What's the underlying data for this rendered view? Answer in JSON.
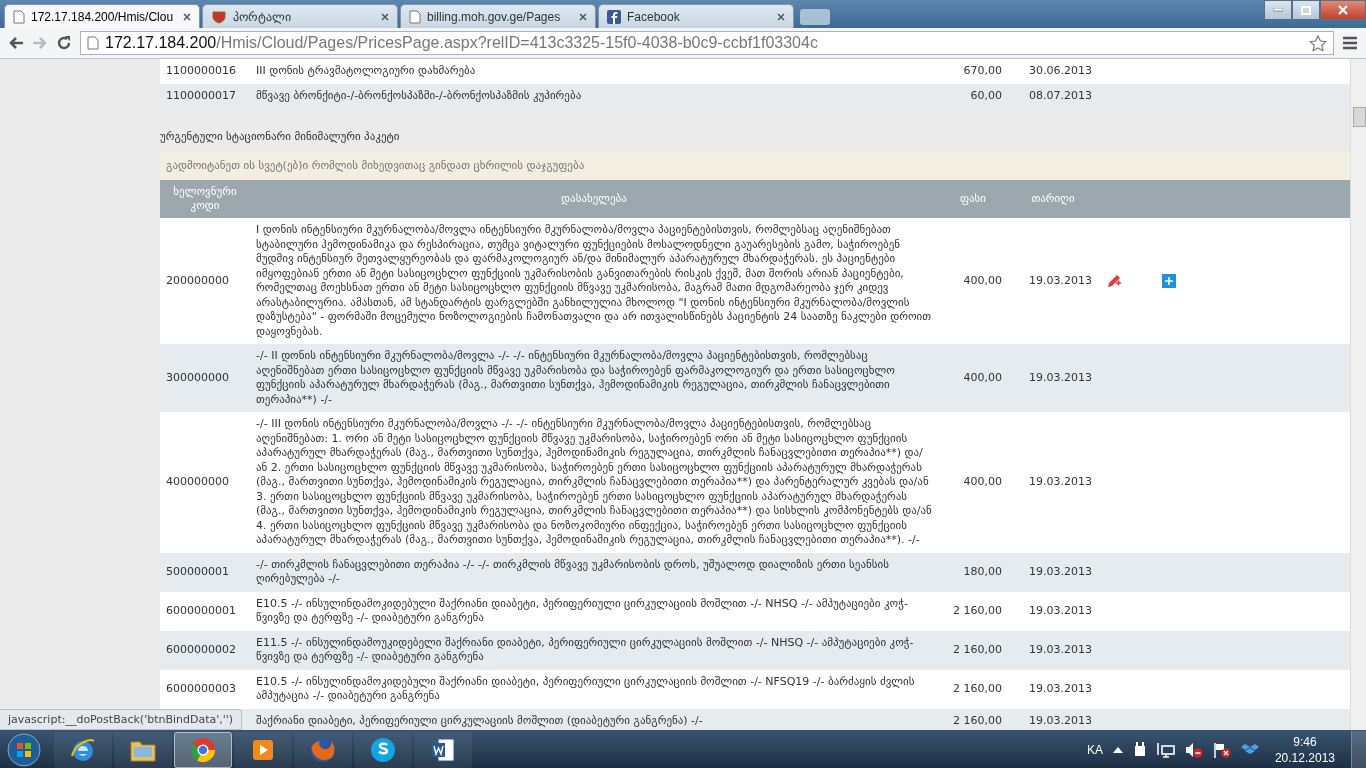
{
  "browser": {
    "tabs": [
      {
        "title": "172.17.184.200/Hmis/Clou",
        "kind": "page",
        "selected": true
      },
      {
        "title": "პორტალი",
        "kind": "emblem",
        "selected": false
      },
      {
        "title": "billing.moh.gov.ge/Pages",
        "kind": "page",
        "selected": false
      },
      {
        "title": "Facebook",
        "kind": "facebook",
        "selected": false
      }
    ],
    "address": {
      "host": "172.17.184.200",
      "path": "/Hmis/Cloud/Pages/PricesPage.aspx?relID=413c3325-15f0-4038-b0c9-ccbf1f03304c"
    }
  },
  "previous_rows": [
    {
      "code": "1100000016",
      "name": "III დონის ტრავმატოლოგიური დახმარება",
      "price": "670,00",
      "date": "30.06.2013"
    },
    {
      "code": "1100000017",
      "name": "მწვავე ბრონქიტი-/-ბრონქოსპაზმი-/-ბრონქოსპაზმის კუპირება",
      "price": "60,00",
      "date": "08.07.2013"
    }
  ],
  "section_title": "ურგენტული სტაციონარი მინიმალური პაკეტი",
  "group_hint": "გადმოიტანეთ ის სვეტ(ებ)ი რომლის მიხედვითაც გინდათ ცხრილის დაჯგუფება",
  "table": {
    "columns": [
      "ხელოვნური კოდი",
      "დასახელება",
      "ფასი",
      "თარიღი"
    ],
    "rows": [
      {
        "code": "200000000",
        "name": "I დონის ინტენსიური მკურნალობა/მოვლა ინტენსიური მკურნალობა/მოვლა პაციენტებისთვის, რომლებსაც აღენიშნებათ სტაბილური ჰემოდინამიკა და რესპირაცია, თუმცა ვიტალური ფუნქციების მოსალოდნელი გაუარესების გამო, საჭიროებენ მუდმივ ინტენსიურ მეთვალყურეობას და ფარმაკოლოგიურ ან/და მინიმალურ აპარატურულ მხარდაჭერას. ეს პაციენტები იმყოფებიან ერთი ან მეტი სასიცოცხლო ფუნქციის უკმარისობის განვითარების რისკის ქვეშ, მათ შორის არიან პაციენტები, რომელთაც მოეხსნათ ერთი ან მეტი სასიცოცხლო ფუნქციის მწვავე უკმარისობა, მაგრამ მათი მდგომარეობა ჯერ კიდევ არასტაბილურია. ამასთან, ამ სტანდარტის ფარგლებში განხილულია მხოლოდ \"I დონის ინტენსიური მკურნალობა/მოვლის დაზუსტება\" - ფორმაში მოცემული ნოზოლოგიების ჩამონათვალი და არ ითვალისწინებს პაციენტის 24 საათზე ნაკლები დროით დაყოვნებას.",
        "price": "400,00",
        "date": "19.03.2013",
        "hovered": true
      },
      {
        "code": "300000000",
        "name": "-/- II დონის ინტენსიური მკურნალობა/მოვლა -/- -/- ინტენსიური მკურნალობა/მოვლა პაციენტებისთვის, რომლებსაც აღენიშნებათ ერთი სასიცოცხლო ფუნქციის მწვავე უკმარისობა და საჭიროებენ ფარმაკოლოგიურ და ერთი სასიცოცხლო ფუნქციის აპარატურულ მხარდაჭერას (მაგ., მართვითი სუნთქვა, ჰემოდინამიკის რეგულაცია, თირკმლის ჩანაცვლებითი თერაპია**) -/-",
        "price": "400,00",
        "date": "19.03.2013",
        "hovered": false
      },
      {
        "code": "400000000",
        "name": "-/- III დონის ინტენსიური მკურნალობა/მოვლა -/- -/- ინტენსიური მკურნალობა/მოვლა პაციენტებისთვის, რომლებსაც აღენიშნებათ: 1. ორი ან მეტი სასიცოცხლო ფუნქციის მწვავე უკმარისობა, საჭიროებენ ორი ან მეტი სასიცოცხლო ფუნქციის აპარატურულ მხარდაჭერას (მაგ., მართვითი სუნთქვა, ჰემოდინამიკის რეგულაცია, თირკმლის ჩანაცვლებითი თერაპია**) და/ან 2. ერთი სასიცოცხლო ფუნქციის მწვავე უკმარისობა, საჭიროებენ ერთი სასიცოცხლო ფუნქციის აპარატურულ მხარდაჭერას (მაგ., მართვითი სუნთქვა, ჰემოდინამიკის რეგულაცია, თირკმლის ჩანაცვლებითი თერაპია**) და პარენტერალურ კვებას და/ან 3. ერთი სასიცოცხლო ფუნქციის მწვავე უკმარისობა, საჭიროებენ ერთი სასიცოცხლო ფუნქციის აპარატურულ მხარდაჭერას (მაგ., მართვითი სუნთქვა, ჰემოდინამიკის რეგულაცია, თირკმლის ჩანაცვლებითი თერაპია**) და სისხლის კომპონენტებს და/ან 4. ერთი სასიცოცხლო ფუნქციის მწვავე უკმარისობა და ნოზოკომიური ინფექცია, საჭიროებენ ერთი სასიცოცხლო ფუნქციის აპარატურულ მხარდაჭერას (მაგ., მართვითი სუნთქვა, ჰემოდინამიკის რეგულაცია, თირკმლის ჩანაცვლებითი თერაპია**). -/-",
        "price": "400,00",
        "date": "19.03.2013",
        "hovered": false
      },
      {
        "code": "500000001",
        "name": "-/- თირკმლის ჩანაცვლებითი თერაპია -/- -/- თირკმლის მწვავე უკმარისობის დროს, უშუალოდ დიალიზის ერთი სეანსის ღირებულება -/-",
        "price": "180,00",
        "date": "19.03.2013",
        "hovered": false
      },
      {
        "code": "6000000001",
        "name": "E10.5 -/- ინსულინდამოკიდებული შაქრიანი დიაბეტი, პერიფერიული ცირკულაციის მოშლით -/- NHSQ -/- ამპუტაციები კოჭ-წვივზე და ტერფზე -/- დიაბეტური განგრენა",
        "price": "2 160,00",
        "date": "19.03.2013",
        "hovered": false
      },
      {
        "code": "6000000002",
        "name": "E11.5 -/- ინსულინდამოუკიდებელი შაქრიანი დიაბეტი, პერიფერიული ცირკულაციის მოშლით -/- NHSQ -/- ამპუტაციები კოჭ-წვივზე და ტერფზე -/- დიაბეტური განგრენა",
        "price": "2 160,00",
        "date": "19.03.2013",
        "hovered": false
      },
      {
        "code": "6000000003",
        "name": "E10.5 -/- ინსულინდამოკიდებული შაქრიანი დიაბეტი, პერიფერიული ცირკულაციის მოშლით -/- NFSQ19 -/- ბარძაყის ძვლის ამპუტაცია -/- დიაბეტური განგრენა",
        "price": "2 160,00",
        "date": "19.03.2013",
        "hovered": false
      },
      {
        "name": "შაქრიანი დიაბეტი, პერიფერიული ცირკულაციის მოშლით (დიაბეტური განგრენა) -/-",
        "price": "2 160,00",
        "date": "19.03.2013",
        "hovered": false
      }
    ]
  },
  "status_text": "javascript:__doPostBack('btnBindData','')",
  "taskbar": {
    "apps": [
      {
        "kind": "ie",
        "selected": false
      },
      {
        "kind": "folder",
        "selected": false
      },
      {
        "kind": "chrome",
        "selected": true
      },
      {
        "kind": "player",
        "selected": false
      },
      {
        "kind": "firefox",
        "selected": false
      },
      {
        "kind": "skype",
        "selected": false
      },
      {
        "kind": "word",
        "selected": false
      }
    ],
    "language": "KA",
    "time": "9:46",
    "date": "20.12.2013"
  }
}
